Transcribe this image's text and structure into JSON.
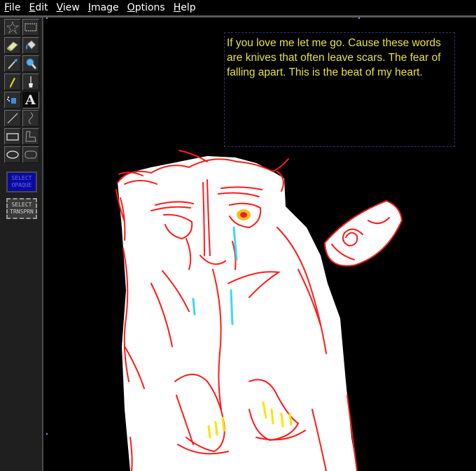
{
  "menu": [
    "File",
    "Edit",
    "View",
    "Image",
    "Options",
    "Help"
  ],
  "tools": [
    {
      "name": "free-select-icon"
    },
    {
      "name": "rect-select-icon"
    },
    {
      "name": "eraser-icon"
    },
    {
      "name": "fill-bucket-icon"
    },
    {
      "name": "color-picker-icon"
    },
    {
      "name": "magnifier-icon"
    },
    {
      "name": "pencil-icon"
    },
    {
      "name": "brush-icon"
    },
    {
      "name": "airbrush-icon"
    },
    {
      "name": "text-icon",
      "glyph": "A"
    },
    {
      "name": "line-icon"
    },
    {
      "name": "curve-icon"
    },
    {
      "name": "rectangle-icon"
    },
    {
      "name": "polygon-icon"
    },
    {
      "name": "ellipse-icon"
    },
    {
      "name": "rounded-rect-icon"
    }
  ],
  "select_opaque_label": "SELECT\nOPAQUE",
  "select_transparent_label": "SELECT\nTRNSPRN",
  "canvas_text": "If you love me let me go. Cause these words are knives that often leave scars. The fear of falling apart. This is the beat of my heart.",
  "colors": {
    "text": "#e8e23a",
    "outline": "#ff1a1a",
    "fill": "#ffffff",
    "tears": "#38d8ff",
    "eye": "#f2c020",
    "background": "#000000"
  }
}
